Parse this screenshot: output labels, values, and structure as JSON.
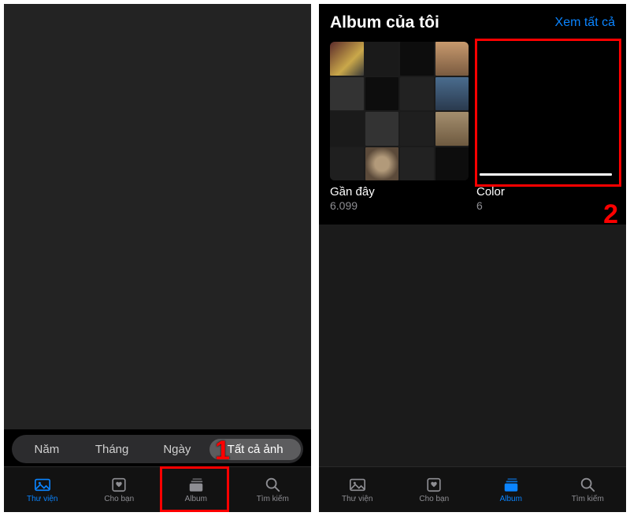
{
  "left": {
    "segments": {
      "year": "Năm",
      "month": "Tháng",
      "day": "Ngày",
      "all": "Tất cả ảnh"
    },
    "tabs": {
      "library": "Thư viện",
      "forYou": "Cho bạn",
      "album": "Album",
      "search": "Tìm kiếm"
    }
  },
  "right": {
    "header": {
      "title": "Album của tôi",
      "seeAll": "Xem tất cả"
    },
    "albums": [
      {
        "label": "Gần đây",
        "count": "6.099"
      },
      {
        "label": "Color",
        "count": "6"
      }
    ],
    "tabs": {
      "library": "Thư viện",
      "forYou": "Cho bạn",
      "album": "Album",
      "search": "Tìm kiếm"
    }
  },
  "annotations": {
    "one": "1",
    "two": "2"
  }
}
